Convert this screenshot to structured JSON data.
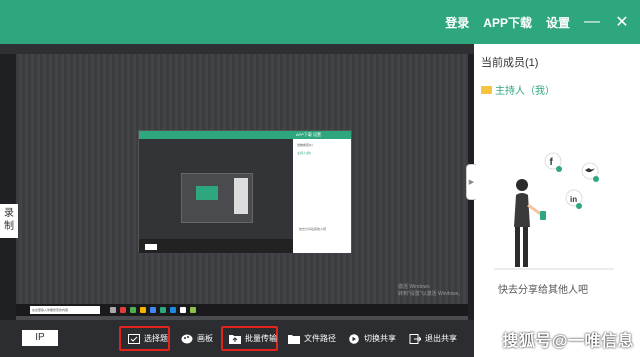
{
  "titlebar": {
    "login": "登录",
    "app_download": "APP下载",
    "settings": "设置",
    "minimize": "—",
    "close": "✕"
  },
  "shared_screen": {
    "nested_window": {
      "title_links": "APP下载   设置",
      "members": "当前成员(1)",
      "host": "主持人(我)",
      "share_text": "快去分享给其他人吧"
    },
    "windows_watermark": "激活 Windows\n转到\"设置\"以激活 Windows。",
    "taskbar_search": "在这里输入你要搜索的内容"
  },
  "record_tab": "录制",
  "toolbar": {
    "ip_label": "IP",
    "items": [
      {
        "label": "选择题",
        "icon": "choice-icon",
        "highlighted": true
      },
      {
        "label": "画板",
        "icon": "palette-icon",
        "highlighted": false
      },
      {
        "label": "批量传输",
        "icon": "folder-upload-icon",
        "highlighted": true
      },
      {
        "label": "文件路径",
        "icon": "folder-icon",
        "highlighted": false
      },
      {
        "label": "切换共享",
        "icon": "play-icon",
        "highlighted": false
      },
      {
        "label": "退出共享",
        "icon": "exit-icon",
        "highlighted": false
      }
    ]
  },
  "panel": {
    "members_title": "当前成员(1)",
    "host_label": "主持人（我）",
    "share_hint": "快去分享给其他人吧",
    "collapse_glyph": "▶"
  },
  "watermark": "搜狐号@一唯信息",
  "colors": {
    "brand": "#2fa77e",
    "highlight": "#e1231c",
    "toolbar_bg": "#2b2d30"
  }
}
